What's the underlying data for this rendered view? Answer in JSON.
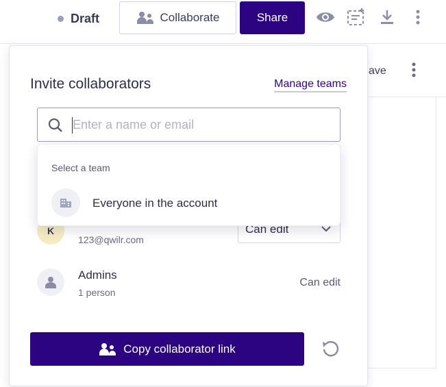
{
  "toolbar": {
    "status": "Draft",
    "collaborate_label": "Collaborate",
    "share_label": "Share"
  },
  "background": {
    "save_fragment": "ave"
  },
  "popover": {
    "title": "Invite collaborators",
    "manage_teams": "Manage teams",
    "search_placeholder": "Enter a name or email",
    "dropdown": {
      "header": "Select a team",
      "items": [
        {
          "label": "Everyone in the account",
          "icon": "building-icon"
        }
      ]
    },
    "collaborators": [
      {
        "initial": "K",
        "name": "",
        "email": "123@qwilr.com",
        "permission": "Can edit",
        "avatar_color": "#f6ecc4"
      },
      {
        "name": "Admins",
        "sub": "1 person",
        "permission": "Can edit",
        "icon": "person-icon"
      }
    ],
    "copy_link_label": "Copy collaborator link"
  },
  "colors": {
    "brand": "#2c0381",
    "text": "#2e2e4a",
    "muted": "#6a6a82"
  }
}
